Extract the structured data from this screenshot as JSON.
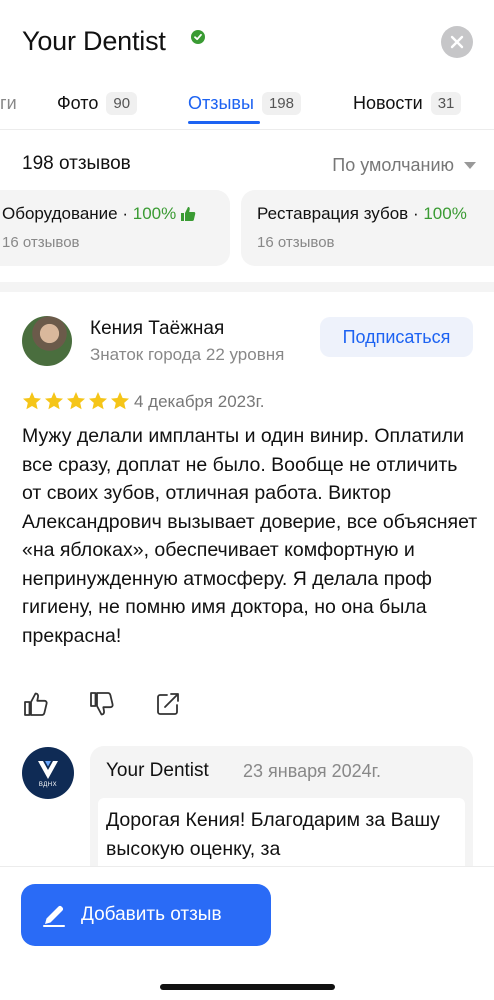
{
  "header": {
    "title": "Your Dentist",
    "close_icon": "close-icon",
    "verified_icon": "verified-icon"
  },
  "tabs": {
    "partial": "ги",
    "items": [
      {
        "label": "Фото",
        "count": "90"
      },
      {
        "label": "Отзывы",
        "count": "198",
        "active": true
      },
      {
        "label": "Новости",
        "count": "31"
      }
    ]
  },
  "summary": {
    "count_text": "198 отзывов",
    "sort_label": "По умолчанию"
  },
  "aspects": [
    {
      "title": "Оборудование",
      "sep": " · ",
      "percent": "100%",
      "count": "16 отзывов"
    },
    {
      "title": "Реставрация зубов",
      "sep": " · ",
      "percent": "100%",
      "count": "16 отзывов"
    }
  ],
  "review": {
    "author": "Кения Таёжная",
    "level": "Знаток города 22 уровня",
    "subscribe_label": "Подписаться",
    "rating": 5,
    "date": "4 декабря 2023г.",
    "text": "Мужу делали импланты и один винир. Оплатили все сразу, доплат не было. Вообще не отличить от своих зубов, отличная работа. Виктор Александрович вызывает доверие, все объясняет «на яблоках», обеспечивает комфортную и непринужденную атмосферу. Я делала проф гигиену, не помню имя доктора, но она была прекрасна!",
    "actions": [
      "thumb-up-icon",
      "thumb-down-icon",
      "share-icon"
    ]
  },
  "reply": {
    "logo_text": "ВДНХ",
    "author": "Your Dentist",
    "date": "23 января 2024г.",
    "text": "Дорогая Кения! Благодарим за Вашу высокую оценку, за"
  },
  "bottom": {
    "add_review_label": "Добавить отзыв"
  },
  "colors": {
    "accent": "#1d63f2",
    "button": "#2a6bf6",
    "positive": "#3a9b33",
    "star": "#f5c518"
  }
}
